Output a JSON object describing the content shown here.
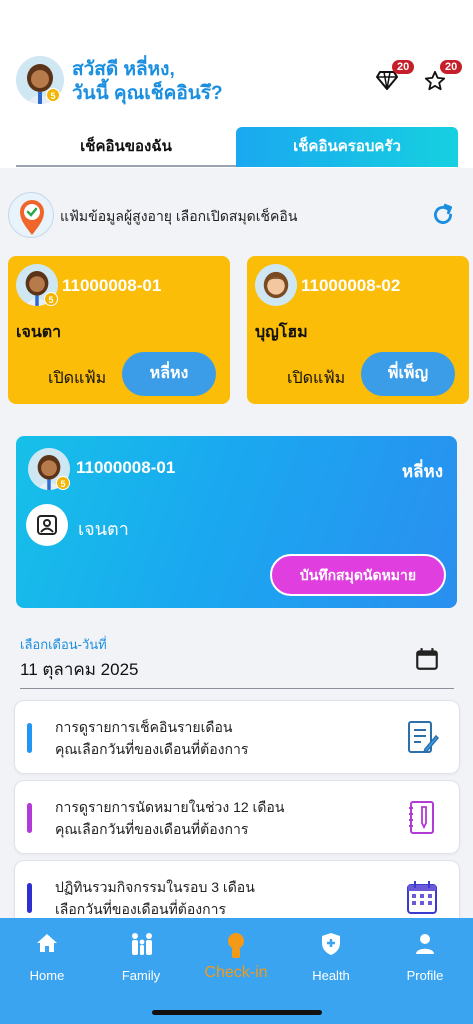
{
  "header": {
    "greeting_line1": "สวัสดี หลี่หง,",
    "greeting_line2": "วันนี้ คุณเช็คอินรึ?",
    "avatar_badge": "5",
    "diamond_count": "20",
    "star_count": "20"
  },
  "tabs": [
    {
      "label": "เช็คอินของฉัน"
    },
    {
      "label": "เช็คอินครอบครัว"
    }
  ],
  "file_section": {
    "text": "แฟ้มข้อมูลผู้สูงอายุ เลือกเปิดสมุดเช็คอิน"
  },
  "cards": [
    {
      "id": "11000008-01",
      "name": "เจนตา",
      "open_label": "เปิดแฟ้ม",
      "button": "หลี่หง",
      "badge": "5"
    },
    {
      "id": "11000008-02",
      "name": "บุญโฮม",
      "open_label": "เปิดแฟ้ม",
      "button": "พี่เพ็ญ"
    }
  ],
  "selected": {
    "id": "11000008-01",
    "owner": "หลี่หง",
    "name": "เจนตา",
    "badge": "5",
    "book_button": "บันทึกสมุดนัดหมาย"
  },
  "date_picker": {
    "label": "เลือกเดือน-วันที่",
    "value": "11 ตุลาคม 2025"
  },
  "list": [
    {
      "line1": "การดูรายการเช็คอินรายเดือน",
      "line2": "คุณเลือกวันที่ของเดือนที่ต้องการ",
      "color": "#2196f3",
      "icon": "notepad-pen-icon"
    },
    {
      "line1": "การดูรายการนัดหมายในช่วง 12 เดือน",
      "line2": "คุณเลือกวันที่ของเดือนที่ต้องการ",
      "color": "#b23ad6",
      "icon": "notebook-icon"
    },
    {
      "line1": "ปฏิทินรวมกิจกรรมในรอบ 3 เดือน",
      "line2": "เลือกวันที่ของเดือนที่ต้องการ",
      "color": "#2f2fcf",
      "icon": "calendar-icon"
    }
  ],
  "nav": [
    {
      "label": "Home"
    },
    {
      "label": "Family"
    },
    {
      "label": "Check-in"
    },
    {
      "label": "Health"
    },
    {
      "label": "Profile"
    }
  ]
}
